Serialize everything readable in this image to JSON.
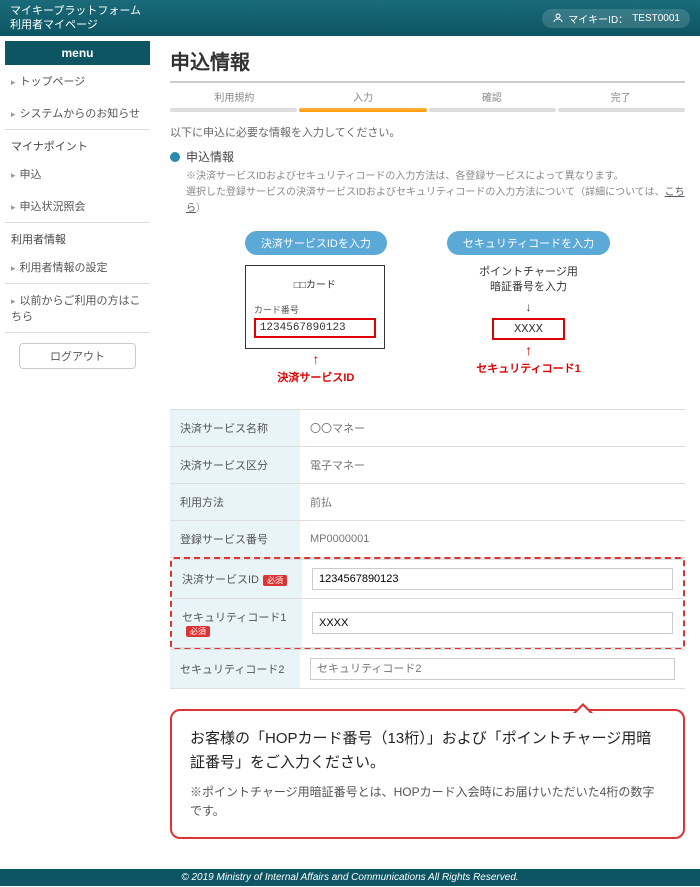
{
  "header": {
    "line1": "マイキープラットフォーム",
    "line2": "利用者マイページ",
    "id_label": "マイキーID：",
    "id_value": "TEST0001"
  },
  "sidebar": {
    "menu_label": "menu",
    "group1": [
      "トップページ",
      "システムからのお知らせ"
    ],
    "group2_title": "マイナポイント",
    "group2": [
      "申込",
      "申込状況照会"
    ],
    "group3_title": "利用者情報",
    "group3": [
      "利用者情報の設定"
    ],
    "group4": [
      "以前からご利用の方はこちら"
    ],
    "logout": "ログアウト"
  },
  "page": {
    "title": "申込情報",
    "steps": [
      "利用規約",
      "入力",
      "確認",
      "完了"
    ],
    "intro": "以下に申込に必要な情報を入力してください。",
    "section_title": "申込情報",
    "sub1": "※決済サービスIDおよびセキュリティコードの入力方法は、各登録サービスによって異なります。",
    "sub2_a": "選択した登録サービスの決済サービスIDおよびセキュリティコードの入力方法について（詳細については、",
    "sub2_link": "こちら",
    "sub2_b": "）"
  },
  "diagram": {
    "left_btn": "決済サービスIDを入力",
    "card_title": "□□カード",
    "card_label": "カード番号",
    "card_number": "1234567890123",
    "left_caption": "決済サービスID",
    "right_btn": "セキュリティコードを入力",
    "right_instr1": "ポイントチャージ用",
    "right_instr2": "暗証番号を入力",
    "pin_sample": "XXXX",
    "right_caption": "セキュリティコード1"
  },
  "form": {
    "rows": [
      {
        "label": "決済サービス名称",
        "value": "〇〇マネー"
      },
      {
        "label": "決済サービス区分",
        "value": "電子マネー"
      },
      {
        "label": "利用方法",
        "value": "前払"
      },
      {
        "label": "登録サービス番号",
        "value": "MP0000001"
      }
    ],
    "input1_label": "決済サービスID",
    "input1_value": "1234567890123",
    "input2_label": "セキュリティコード1",
    "input2_value": "XXXX",
    "input3_label": "セキュリティコード2",
    "input3_placeholder": "セキュリティコード2",
    "required": "必須"
  },
  "callout": {
    "main": "お客様の「HOPカード番号（13桁）」および「ポイントチャージ用暗証番号」をご入力ください。",
    "sub": "※ポイントチャージ用暗証番号とは、HOPカード入会時にお届けいただいた4桁の数字です。"
  },
  "footer": "© 2019 Ministry of Internal Affairs and Communications All Rights Reserved."
}
